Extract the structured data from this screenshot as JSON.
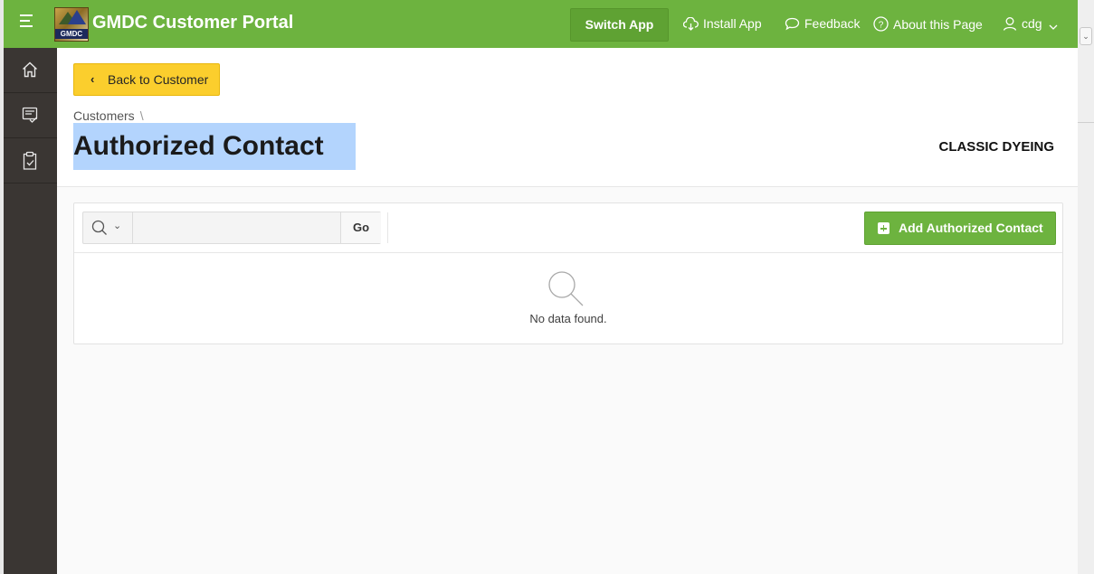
{
  "header": {
    "app_title": "GMDC Customer Portal",
    "logo_text": "GMDC",
    "switch_app_label": "Switch App",
    "install_app_label": "Install App",
    "feedback_label": "Feedback",
    "about_label": "About this Page",
    "user_label": "cdg",
    "brand_color": "#6db33f"
  },
  "nav": {
    "items": [
      {
        "icon": "home-icon"
      },
      {
        "icon": "checklist-icon"
      },
      {
        "icon": "clipboard-check-icon"
      }
    ]
  },
  "page": {
    "back_button_label": "Back to Customer",
    "breadcrumb_parent": "Customers",
    "breadcrumb_separator": "\\",
    "title": "Authorized Contact",
    "customer_name": "CLASSIC DYEING"
  },
  "report": {
    "search_value": "",
    "go_label": "Go",
    "add_button_label": "Add Authorized Contact",
    "empty_message": "No data found."
  }
}
